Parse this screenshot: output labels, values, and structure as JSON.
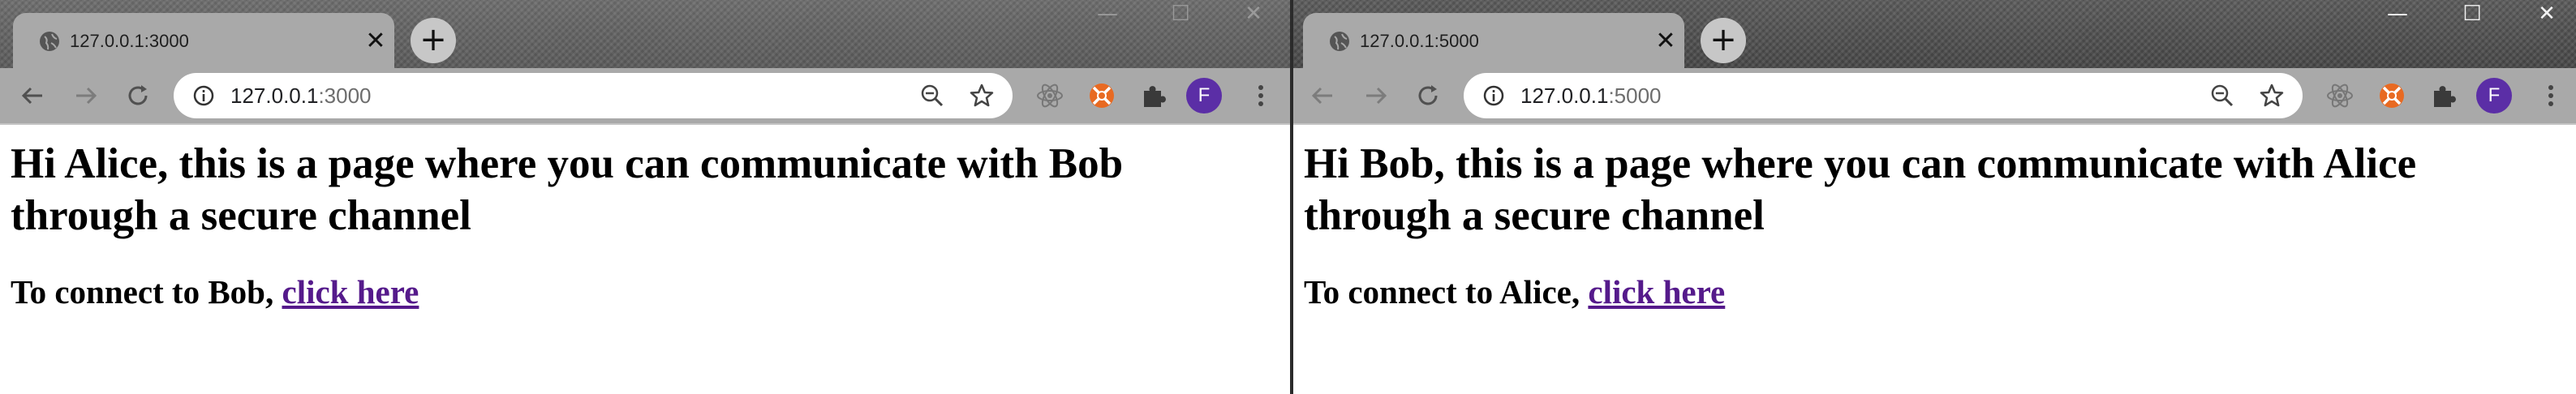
{
  "left_window": {
    "tab": {
      "title": "127.0.0.1:3000",
      "close": "✕"
    },
    "new_tab": "+",
    "address": {
      "host": "127.0.0.1",
      "port": ":3000"
    },
    "profile_initial": "F",
    "window_controls": {
      "minimize": "—",
      "maximize": "☐",
      "close": "✕"
    },
    "page": {
      "heading": "Hi Alice, this is a page where you can communicate with Bob through a secure channel",
      "connect_text": "To connect to Bob, ",
      "connect_link": "click here"
    }
  },
  "right_window": {
    "tab": {
      "title": "127.0.0.1:5000",
      "close": "✕"
    },
    "new_tab": "+",
    "address": {
      "host": "127.0.0.1",
      "port": ":5000"
    },
    "profile_initial": "F",
    "window_controls": {
      "minimize": "—",
      "maximize": "☐",
      "close": "✕"
    },
    "page": {
      "heading": "Hi Bob, this is a page where you can communicate with Alice through a secure channel",
      "connect_text": "To connect to Alice, ",
      "connect_link": "click here"
    }
  },
  "icons": [
    "globe-icon",
    "back-icon",
    "forward-icon",
    "reload-icon",
    "info-icon",
    "zoom-out-icon",
    "star-icon",
    "react-devtools-icon",
    "extension-orange-icon",
    "puzzle-icon",
    "menu-icon"
  ],
  "colors": {
    "link": "#551a8b",
    "profile": "#5b2ea6",
    "toolbar": "#a9a9a9"
  }
}
